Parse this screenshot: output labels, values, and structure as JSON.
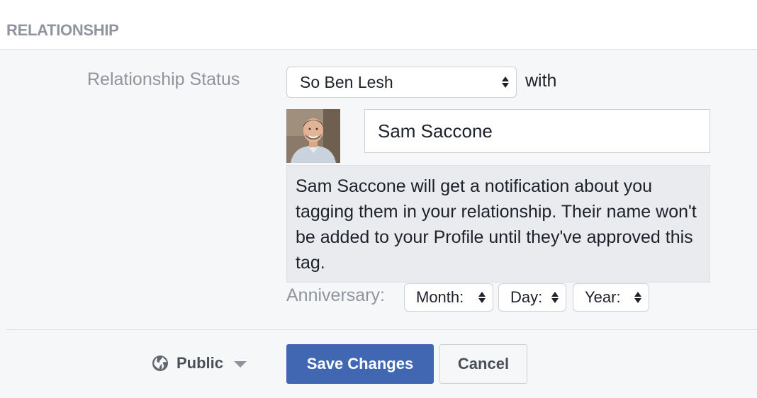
{
  "section": {
    "title": "RELATIONSHIP"
  },
  "relationship": {
    "label": "Relationship Status",
    "status_value": "So Ben Lesh",
    "with_text": "with",
    "partner_name": "Sam Saccone",
    "notice": "Sam Saccone will get a notification about you tagging them in your relationship. Their name won't be added to your Profile until they've approved this tag."
  },
  "anniversary": {
    "label": "Anniversary:",
    "month": "Month:",
    "day": "Day:",
    "year": "Year:"
  },
  "footer": {
    "privacy_label": "Public",
    "privacy_icon": "globe-icon",
    "save_label": "Save Changes",
    "cancel_label": "Cancel"
  },
  "colors": {
    "accent": "#4267b2",
    "background": "#f6f7f9",
    "muted_text": "#90949c",
    "notice_bg": "#e9ebee"
  }
}
